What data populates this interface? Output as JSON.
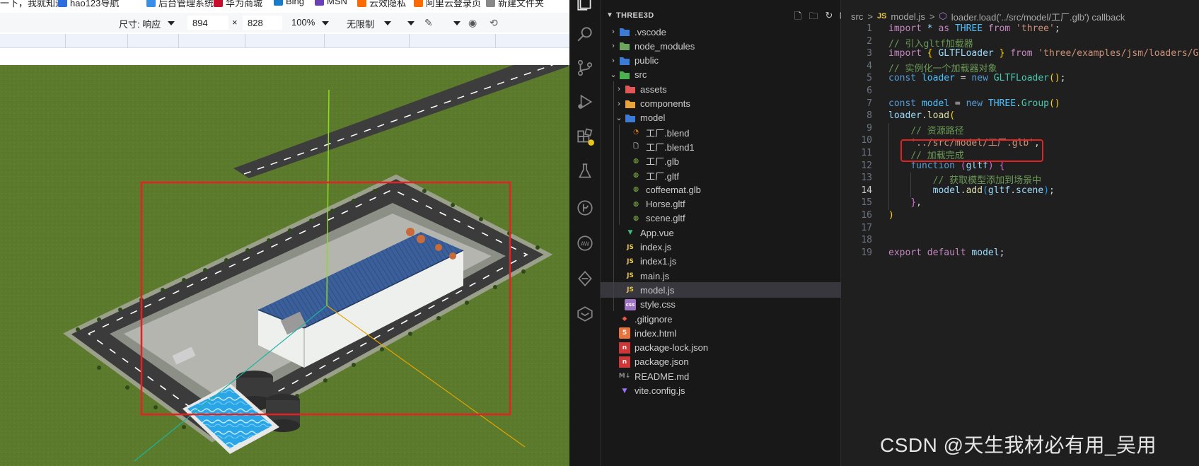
{
  "bookmarks": [
    {
      "label": "搜一下，我就知道",
      "color": "#e44"
    },
    {
      "label": "hao123导航",
      "color": "#2a6ee0"
    },
    {
      "label": "后台管理系统",
      "color": "#3a8ee6"
    },
    {
      "label": "华为商城",
      "color": "#c8102e"
    },
    {
      "label": "Bing",
      "color": "#1a7cc8"
    },
    {
      "label": "MSN",
      "color": "#6b3fb8"
    },
    {
      "label": "云效隐私",
      "color": "#ff6a00"
    },
    {
      "label": "阿里云登录页",
      "color": "#ff6a00"
    },
    {
      "label": "新建文件夹",
      "color": "#888"
    }
  ],
  "devtools_bar": {
    "size_label": "尺寸: 响应",
    "width_value": "894",
    "times": "×",
    "height_value": "828",
    "zoom": "100%",
    "throttle": "无限制"
  },
  "explorer": {
    "title": "THREE3D",
    "tree": [
      {
        "label": ".vscode",
        "depth": 0,
        "type": "folder",
        "expanded": false,
        "icon": "vscode-folder-icon",
        "color": "#3b7bd4"
      },
      {
        "label": "node_modules",
        "depth": 0,
        "type": "folder",
        "expanded": false,
        "icon": "node-folder-icon",
        "color": "#6da55f"
      },
      {
        "label": "public",
        "depth": 0,
        "type": "folder",
        "expanded": false,
        "icon": "public-folder-icon",
        "color": "#3b7bd4"
      },
      {
        "label": "src",
        "depth": 0,
        "type": "folder",
        "expanded": true,
        "icon": "src-folder-icon",
        "color": "#4caf50"
      },
      {
        "label": "assets",
        "depth": 1,
        "type": "folder",
        "expanded": false,
        "icon": "assets-folder-icon",
        "color": "#e15757"
      },
      {
        "label": "components",
        "depth": 1,
        "type": "folder",
        "expanded": false,
        "icon": "components-folder-icon",
        "color": "#e8a33b"
      },
      {
        "label": "model",
        "depth": 1,
        "type": "folder",
        "expanded": true,
        "icon": "model-folder-icon",
        "color": "#3b7bd4"
      },
      {
        "label": "工厂.blend",
        "depth": 2,
        "type": "file",
        "icon": "blender-icon",
        "color": "#e87d0d"
      },
      {
        "label": "工厂.blend1",
        "depth": 2,
        "type": "file",
        "icon": "file-icon",
        "color": "#c5c5c5"
      },
      {
        "label": "工厂.glb",
        "depth": 2,
        "type": "file",
        "icon": "gltf-icon",
        "color": "#8bc34a"
      },
      {
        "label": "工厂.gltf",
        "depth": 2,
        "type": "file",
        "icon": "gltf-icon",
        "color": "#8bc34a"
      },
      {
        "label": "coffeemat.glb",
        "depth": 2,
        "type": "file",
        "icon": "gltf-icon",
        "color": "#8bc34a"
      },
      {
        "label": "Horse.gltf",
        "depth": 2,
        "type": "file",
        "icon": "gltf-icon",
        "color": "#8bc34a"
      },
      {
        "label": "scene.gltf",
        "depth": 2,
        "type": "file",
        "icon": "gltf-icon",
        "color": "#8bc34a"
      },
      {
        "label": "App.vue",
        "depth": 1,
        "type": "file",
        "icon": "vue-icon",
        "color": "#41b883"
      },
      {
        "label": "index.js",
        "depth": 1,
        "type": "file",
        "icon": "js-icon",
        "color": "#e8c84a"
      },
      {
        "label": "index1.js",
        "depth": 1,
        "type": "file",
        "icon": "js-icon",
        "color": "#e8c84a"
      },
      {
        "label": "main.js",
        "depth": 1,
        "type": "file",
        "icon": "js-icon",
        "color": "#e8c84a"
      },
      {
        "label": "model.js",
        "depth": 1,
        "type": "file",
        "icon": "js-icon",
        "color": "#e8c84a",
        "selected": true
      },
      {
        "label": "style.css",
        "depth": 1,
        "type": "file",
        "icon": "css-icon",
        "color": "#a074c4"
      },
      {
        "label": ".gitignore",
        "depth": 0,
        "type": "file",
        "icon": "git-icon",
        "color": "#e8574a"
      },
      {
        "label": "index.html",
        "depth": 0,
        "type": "file",
        "icon": "html-icon",
        "color": "#e8743b"
      },
      {
        "label": "package-lock.json",
        "depth": 0,
        "type": "file",
        "icon": "npm-icon",
        "color": "#cb3837"
      },
      {
        "label": "package.json",
        "depth": 0,
        "type": "file",
        "icon": "npm-icon",
        "color": "#cb3837"
      },
      {
        "label": "README.md",
        "depth": 0,
        "type": "file",
        "icon": "markdown-icon",
        "color": "#8a8a8a"
      },
      {
        "label": "vite.config.js",
        "depth": 0,
        "type": "file",
        "icon": "vite-icon",
        "color": "#a071f6"
      }
    ]
  },
  "breadcrumbs": {
    "folder": "src",
    "sep": ">",
    "js_badge": "JS",
    "file": "model.js",
    "symbol": "loader.load('../src/model/工厂.glb') callback"
  },
  "code": {
    "current_line": 14,
    "lines": [
      {
        "n": "1",
        "html": "<span class='kwf'>import</span> <span class='var'>*</span> <span class='kwf'>as</span> <span class='const'>THREE</span> <span class='kwf'>from</span> <span class='str'>'three'</span>;"
      },
      {
        "n": "2",
        "html": "<span class='cmt'>// 引入gltf加载器</span>"
      },
      {
        "n": "3",
        "html": "<span class='kwf'>import</span> <span class='br1'>{</span> <span class='var'>GLTFLoader</span> <span class='br1'>}</span> <span class='kwf'>from</span> <span class='str'>'three/examples/jsm/loaders/GLTFLoader'</span>"
      },
      {
        "n": "4",
        "html": "<span class='cmt'>// 实例化一个加载器对象</span>"
      },
      {
        "n": "5",
        "html": "<span class='kw'>const</span> <span class='const'>loader</span> = <span class='kw'>new</span> <span class='cls'>GLTFLoader</span><span class='br1'>()</span>;"
      },
      {
        "n": "6",
        "html": ""
      },
      {
        "n": "7",
        "html": "<span class='kw'>const</span> <span class='const'>model</span> = <span class='kw'>new</span> <span class='const'>THREE</span>.<span class='cls'>Group</span><span class='br1'>()</span>"
      },
      {
        "n": "8",
        "html": "<span class='var'>loader</span>.<span class='fn'>load</span><span class='br1'>(</span>"
      },
      {
        "n": "9",
        "html": "    <span class='cmt'>// 资源路径</span>"
      },
      {
        "n": "10",
        "html": "    <span class='str'>'../src/model/工厂.glb'</span>,"
      },
      {
        "n": "11",
        "html": "    <span class='cmt'>// 加载完成</span>"
      },
      {
        "n": "12",
        "html": "    <span class='kw'>function</span> <span class='br2'>(</span><span class='var'>gltf</span><span class='br2'>)</span> <span class='br2'>{</span>"
      },
      {
        "n": "13",
        "html": "        <span class='cmt'>// 获取模型添加到场景中</span>"
      },
      {
        "n": "14",
        "html": "        <span class='var'>model</span>.<span class='fn'>add</span><span class='br3'>(</span><span class='var'>gltf</span>.<span class='var'>scene</span><span class='br3'>)</span>;"
      },
      {
        "n": "15",
        "html": "    <span class='br2'>}</span>,"
      },
      {
        "n": "16",
        "html": "<span class='br1'>)</span>"
      },
      {
        "n": "17",
        "html": ""
      },
      {
        "n": "18",
        "html": ""
      },
      {
        "n": "19",
        "html": "<span class='kwf'>export</span> <span class='kwf'>default</span> <span class='var'>model</span>;"
      }
    ]
  },
  "watermark": "CSDN @天生我材必有用_吴用",
  "colors": {
    "highlight_red": "#e02424",
    "grass": "#5b7a2c",
    "roof": "#3a5f9a"
  }
}
